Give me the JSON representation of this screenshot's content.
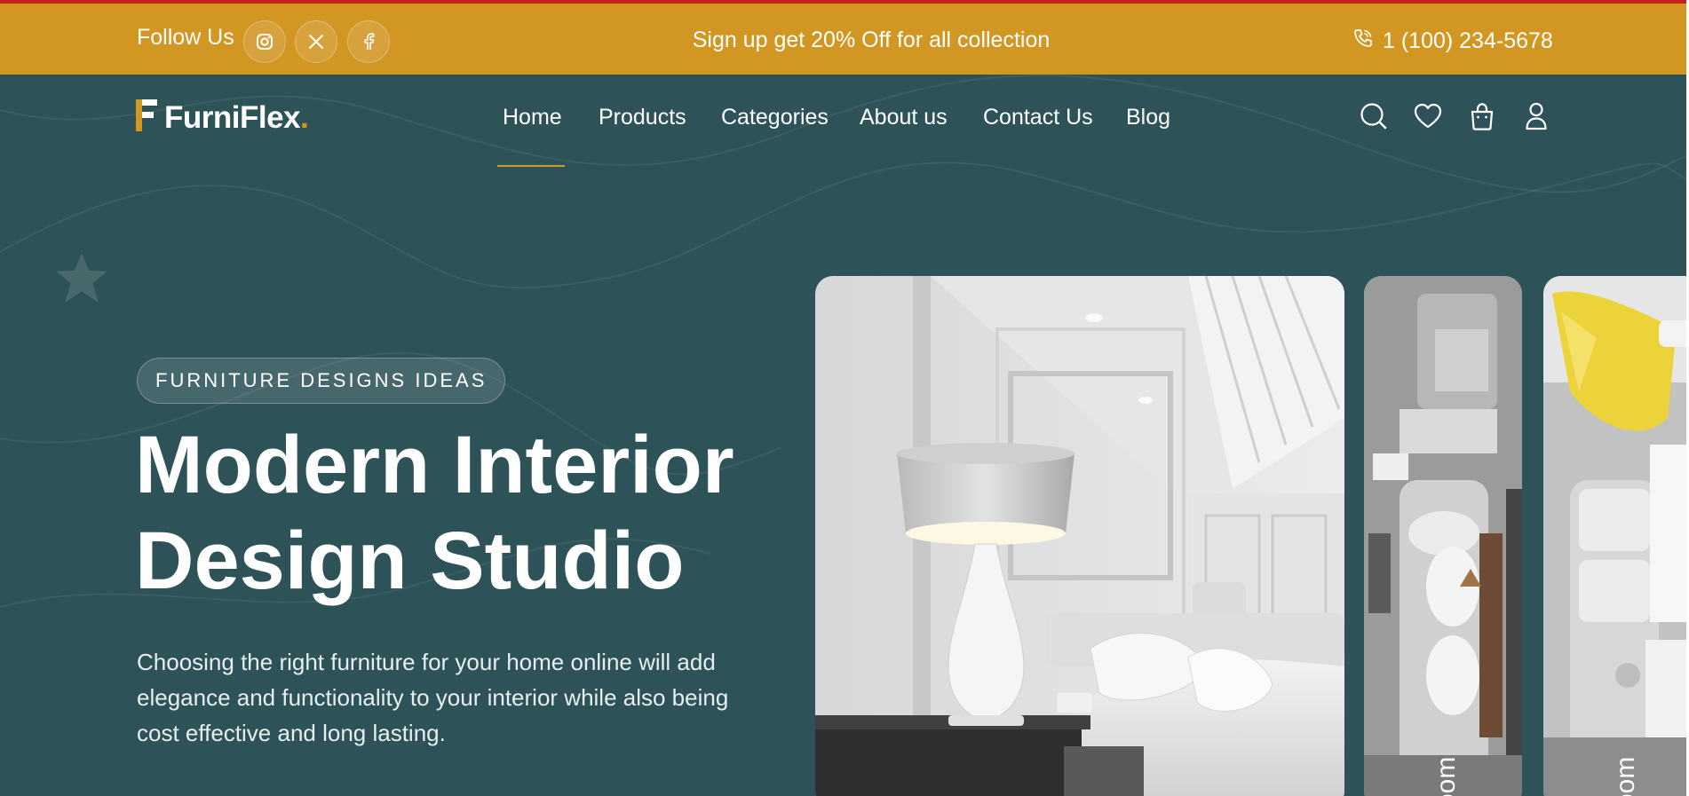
{
  "topbar": {
    "follow_label": "Follow Us",
    "social_icons": [
      "instagram-icon",
      "x-icon",
      "facebook-icon"
    ],
    "promo_text": "Sign up get 20% Off for all collection",
    "phone": "1 (100) 234-5678"
  },
  "nav": {
    "logo_text": "FurniFlex",
    "logo_dot": ".",
    "items": [
      {
        "label": "Home",
        "active": true
      },
      {
        "label": "Products"
      },
      {
        "label": "Categories"
      },
      {
        "label": "About us"
      },
      {
        "label": "Contact Us"
      },
      {
        "label": "Blog"
      }
    ],
    "icons": [
      "search-icon",
      "heart-icon",
      "bag-icon",
      "user-icon"
    ]
  },
  "hero": {
    "badge": "FURNITURE DESIGNS IDEAS",
    "title_line1": "Modern Interior",
    "title_line2": "Design Studio",
    "description": "Choosing the right furniture for your home online will add elegance and functionality to your interior while also being cost effective and long lasting.",
    "card_labels": [
      "oom",
      "oom"
    ]
  },
  "colors": {
    "primary_bg": "#2d5257",
    "accent": "#d29623",
    "top_border": "#c4211c"
  }
}
